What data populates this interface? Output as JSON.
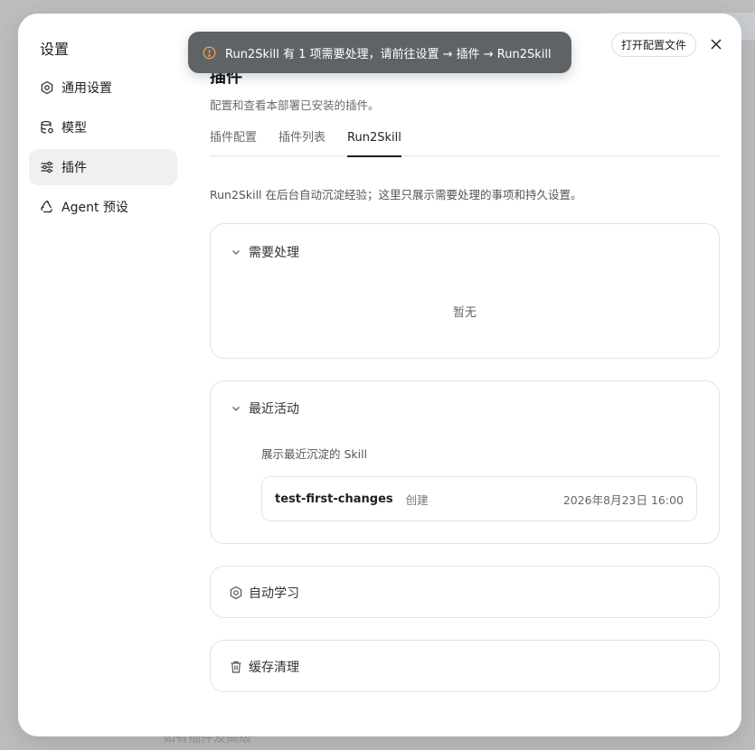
{
  "backdrop": {
    "hint_text": "如有插件及高级"
  },
  "sidebar": {
    "title": "设置",
    "items": [
      {
        "label": "通用设置",
        "icon": "gear-icon",
        "active": false
      },
      {
        "label": "模型",
        "icon": "database-icon",
        "active": false
      },
      {
        "label": "插件",
        "icon": "sliders-icon",
        "active": true
      },
      {
        "label": "Agent 预设",
        "icon": "recycle-icon",
        "active": false
      }
    ]
  },
  "header": {
    "open_config_label": "打开配置文件",
    "close_icon": "close-icon"
  },
  "toast": {
    "icon": "warning-circle-icon",
    "message": "Run2Skill 有 1 项需要处理，请前往设置 → 插件 → Run2Skill",
    "accent": "#f0a04b"
  },
  "main": {
    "title": "插件",
    "description": "配置和查看本部署已安装的插件。",
    "tabs": [
      {
        "label": "插件配置",
        "active": false
      },
      {
        "label": "插件列表",
        "active": false
      },
      {
        "label": "Run2Skill",
        "active": true
      }
    ],
    "intro": "Run2Skill 在后台自动沉淀经验；这里只展示需要处理的事项和持久设置。",
    "pending": {
      "title": "需要处理",
      "empty_text": "暂无"
    },
    "recent": {
      "title": "最近活动",
      "subtitle": "展示最近沉淀的 Skill",
      "items": [
        {
          "name": "test-first-changes",
          "action": "创建",
          "time": "2026年8月23日 16:00"
        }
      ]
    },
    "auto_learn": {
      "title": "自动学习",
      "icon": "gear-icon"
    },
    "cache": {
      "title": "缓存清理",
      "icon": "trash-icon"
    }
  }
}
